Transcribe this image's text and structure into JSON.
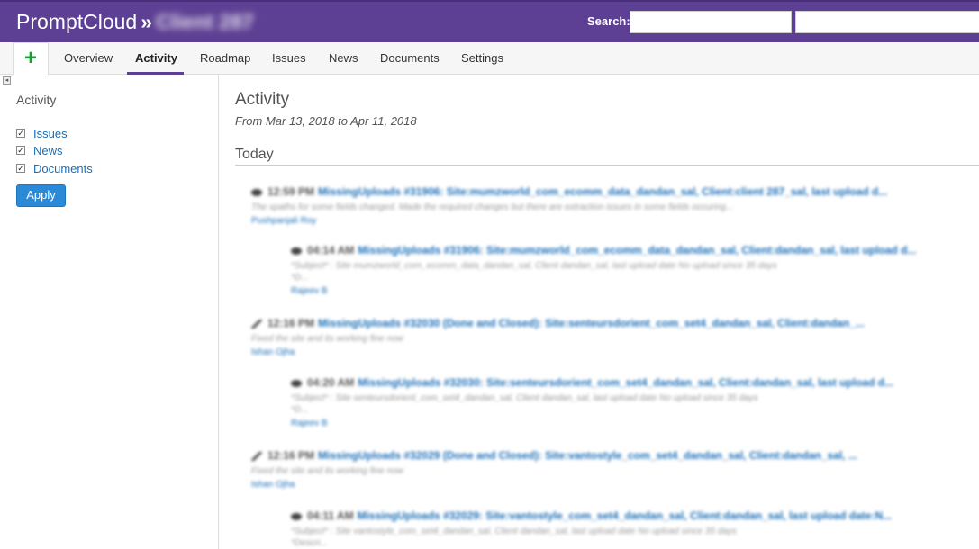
{
  "header": {
    "app_name": "PromptCloud",
    "separator": "»",
    "project_name": "Client 287",
    "search_label": "Search:",
    "search_value": "",
    "jump_value": ""
  },
  "tabs": {
    "new_icon": "+",
    "items": [
      {
        "label": "Overview"
      },
      {
        "label": "Activity",
        "active": true
      },
      {
        "label": "Roadmap"
      },
      {
        "label": "Issues"
      },
      {
        "label": "News"
      },
      {
        "label": "Documents"
      },
      {
        "label": "Settings"
      }
    ]
  },
  "sidebar": {
    "heading": "Activity",
    "options": [
      {
        "label": "Issues",
        "checked": true
      },
      {
        "label": "News",
        "checked": true
      },
      {
        "label": "Documents",
        "checked": true
      }
    ],
    "apply_label": "Apply"
  },
  "main": {
    "title": "Activity",
    "date_range": "From Mar 13, 2018 to Apr 11, 2018",
    "day_heading": "Today",
    "entries": [
      {
        "icon": "comment-icon",
        "time": "12:59 PM",
        "title": "MissingUploads #31906: Site:mumzworld_com_ecomm_data_dandan_sal, Client:client 287_sal, last upload d...",
        "desc": "The xpaths for some fields changed. Made the required changes but there are extraction issues in some fields occuring...",
        "author": "Pushpanjali Roy"
      },
      {
        "icon": "comment-icon",
        "time": "04:14 AM",
        "title": "MissingUploads #31906: Site:mumzworld_com_ecomm_data_dandan_sal, Client:dandan_sal, last upload d...",
        "desc": "*Subject* : Site mumzworld_com_ecomm_data_dandan_sal, Client dandan_sal, last upload date No upload since 35 days",
        "desc2": "*D...",
        "author": "Rajeev B"
      },
      {
        "icon": "edit-icon",
        "time": "12:16 PM",
        "title": "MissingUploads #32030 (Done and Closed): Site:senteursdorient_com_set4_dandan_sal, Client:dandan_...",
        "desc": "Fixed the site and its working fine now",
        "author": "Ishan Ojha"
      },
      {
        "icon": "comment-icon",
        "time": "04:20 AM",
        "title": "MissingUploads #32030: Site:senteursdorient_com_set4_dandan_sal, Client:dandan_sal, last upload d...",
        "desc": "*Subject* : Site senteursdorient_com_set4_dandan_sal, Client dandan_sal, last upload date No upload since 35 days",
        "desc2": "*D...",
        "author": "Rajeev B"
      },
      {
        "icon": "edit-icon",
        "time": "12:16 PM",
        "title": "MissingUploads #32029 (Done and Closed): Site:vantostyle_com_set4_dandan_sal, Client:dandan_sal, ...",
        "desc": "Fixed the site and its working fine now",
        "author": "Ishan Ojha"
      },
      {
        "icon": "comment-icon",
        "time": "04:11 AM",
        "title": "MissingUploads #32029: Site:vantostyle_com_set4_dandan_sal, Client:dandan_sal, last upload date:N...",
        "desc": "*Subject* : Site vantostyle_com_set4_dandan_sal, Client dandan_sal, last upload date No upload since 35 days",
        "desc2": "*Descri...",
        "author": ""
      }
    ]
  }
}
